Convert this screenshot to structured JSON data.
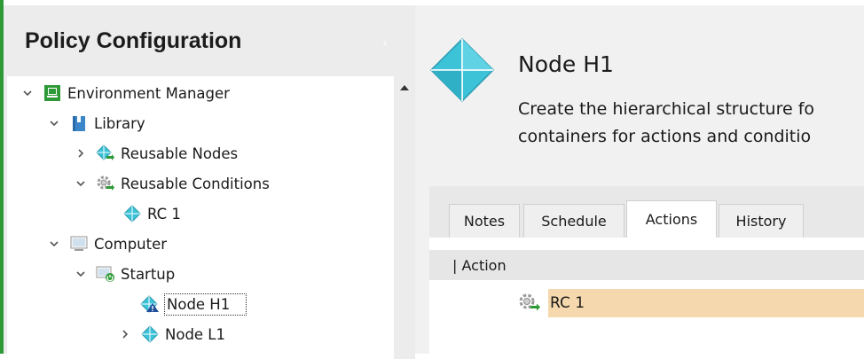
{
  "panel": {
    "title": "Policy Configuration",
    "collapse_icon": "chevron-left-icon"
  },
  "tree": {
    "items": [
      {
        "label": "Environment Manager",
        "icon": "monitor-icon"
      },
      {
        "label": "Library",
        "icon": "book-icon"
      },
      {
        "label": "Reusable Nodes",
        "icon": "reusable-node-icon"
      },
      {
        "label": "Reusable Conditions",
        "icon": "reusable-condition-gear-icon"
      },
      {
        "label": "RC 1",
        "icon": "node-diamond-icon"
      },
      {
        "label": "Computer",
        "icon": "computer-icon"
      },
      {
        "label": "Startup",
        "icon": "startup-icon"
      },
      {
        "label": "Node H1",
        "icon": "node-warning-icon"
      },
      {
        "label": "Node L1",
        "icon": "node-diamond-icon"
      }
    ]
  },
  "node": {
    "title": "Node H1",
    "desc_line1": "Create the hierarchical structure fo",
    "desc_line2": "containers for actions and conditio"
  },
  "tabs": [
    {
      "label": "Notes",
      "active": false
    },
    {
      "label": "Schedule",
      "active": false
    },
    {
      "label": "Actions",
      "active": true
    },
    {
      "label": "History",
      "active": false
    }
  ],
  "grid": {
    "header": "| Action",
    "rows": [
      {
        "label": "RC 1",
        "icon": "reusable-condition-gear-icon"
      }
    ]
  },
  "colors": {
    "accent_green": "#2e9a37",
    "node_cyan": "#3cc3d8",
    "row_highlight": "#f5d8ad"
  }
}
